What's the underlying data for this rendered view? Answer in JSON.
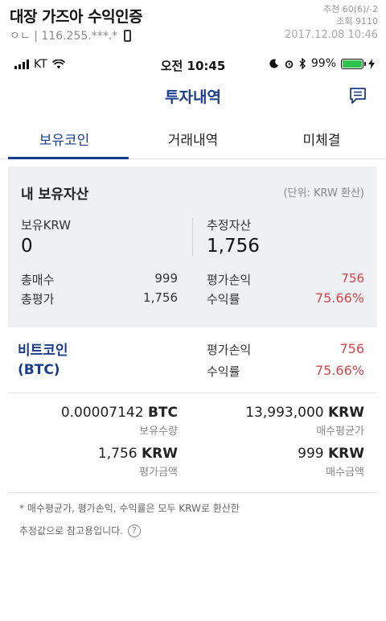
{
  "post": {
    "title": "대장 가즈아 수익인증",
    "author_ip": "ㅇㄴ | 116.255.***.*",
    "recommend": "추천 60(6)/-2",
    "views": "조회 9110",
    "date": "2017.12.08 10:46"
  },
  "status_bar": {
    "carrier": "KT",
    "time": "오전 10:45",
    "battery": "99%",
    "battery_color": "#2fc34d"
  },
  "app": {
    "title": "투자내역",
    "accent": "#1a3d8f"
  },
  "tabs": [
    {
      "label": "보유코인",
      "active": true
    },
    {
      "label": "거래내역",
      "active": false
    },
    {
      "label": "미체결",
      "active": false
    }
  ],
  "summary": {
    "title": "내 보유자산",
    "unit_note": "(단위: KRW 환산)",
    "krw_label": "보유KRW",
    "krw_value": "0",
    "est_label": "추정자산",
    "est_value": "1,756",
    "total_buy_label": "총매수",
    "total_buy_value": "999",
    "total_eval_label": "총평가",
    "total_eval_value": "1,756",
    "pl_label": "평가손익",
    "pl_value": "756",
    "rate_label": "수익률",
    "rate_value": "75.66%",
    "loss_color": "#d64545"
  },
  "coin": {
    "name_line1": "비트코인",
    "name_line2": "(BTC)",
    "pl_label": "평가손익",
    "pl_value": "756",
    "rate_label": "수익률",
    "rate_value": "75.66%",
    "holding_amount": "0.00007142",
    "holding_unit": "BTC",
    "holding_caption": "보유수량",
    "avg_price": "13,993,000",
    "avg_price_unit": "KRW",
    "avg_price_caption": "매수평균가",
    "eval_amount": "1,756",
    "eval_unit": "KRW",
    "eval_caption": "평가금액",
    "buy_amount": "999",
    "buy_unit": "KRW",
    "buy_caption": "매수금액"
  },
  "notes": {
    "line1": "* 매수평균가, 평가손익, 수익률은 모두 KRW로 환산한",
    "line2": "추정값으로 참고용입니다."
  }
}
